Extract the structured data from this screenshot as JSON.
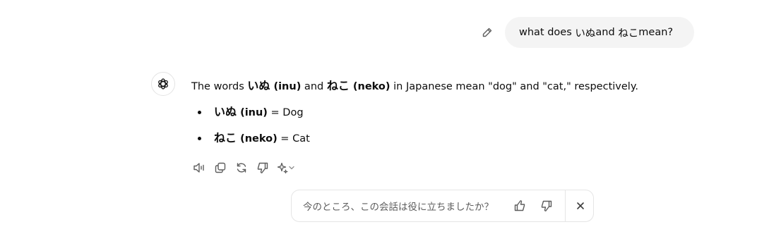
{
  "user_message": {
    "prefix": "what does ",
    "word1": "いぬ",
    "middle": " and ",
    "word2": "ねこ",
    "suffix": " mean?"
  },
  "assistant_message": {
    "intro": {
      "t1": "The words ",
      "w1": "いぬ",
      "r1": " (inu)",
      "t2": " and ",
      "w2": "ねこ",
      "r2": " (neko)",
      "t3": " in Japanese mean \"dog\" and \"cat,\" respectively."
    },
    "items": [
      {
        "word": "いぬ",
        "reading": " (inu)",
        "meaning": " = Dog"
      },
      {
        "word": "ねこ",
        "reading": " (neko)",
        "meaning": " = Cat"
      }
    ]
  },
  "actions": {
    "icons": [
      "read-aloud-icon",
      "copy-icon",
      "regenerate-icon",
      "thumbs-down-icon",
      "sparkle-icon",
      "chevron-down-icon"
    ]
  },
  "feedback": {
    "prompt": "今のところ、この会話は役に立ちましたか？",
    "icons": [
      "thumbs-up-icon",
      "thumbs-down-icon",
      "close-icon"
    ]
  },
  "colors": {
    "bubble_bg": "#f4f4f4",
    "text": "#0d0d0d",
    "icon": "#5d5d5d",
    "border": "#e5e5e5"
  }
}
